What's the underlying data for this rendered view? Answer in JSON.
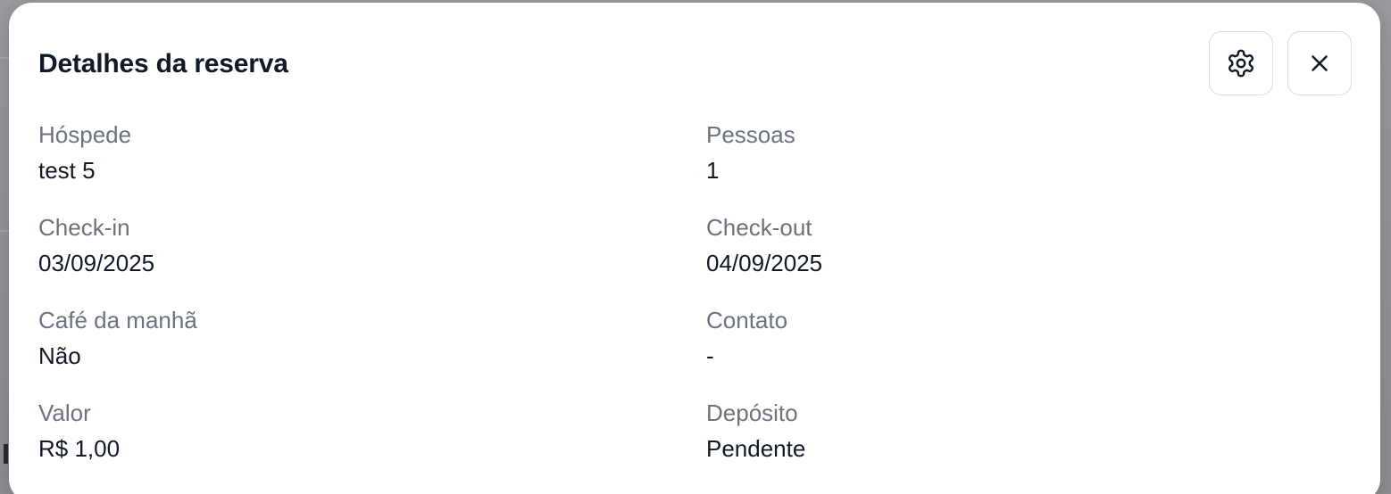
{
  "modal": {
    "title": "Detalhes da reserva",
    "actions": {
      "settings_icon": "gear-icon",
      "close_icon": "close-icon"
    },
    "fields": {
      "guest": {
        "label": "Hóspede",
        "value": "test 5"
      },
      "people": {
        "label": "Pessoas",
        "value": "1"
      },
      "checkin": {
        "label": "Check-in",
        "value": "03/09/2025"
      },
      "checkout": {
        "label": "Check-out",
        "value": "04/09/2025"
      },
      "breakfast": {
        "label": "Café da manhã",
        "value": "Não"
      },
      "contact": {
        "label": "Contato",
        "value": "-"
      },
      "amount": {
        "label": "Valor",
        "value": "R$ 1,00"
      },
      "deposit": {
        "label": "Depósito",
        "value": "Pendente"
      }
    }
  },
  "colors": {
    "overlay": "#8f9094",
    "modal_bg": "#ffffff",
    "text_primary": "#111827",
    "text_muted": "#6b7280",
    "border": "#d9dce1"
  }
}
